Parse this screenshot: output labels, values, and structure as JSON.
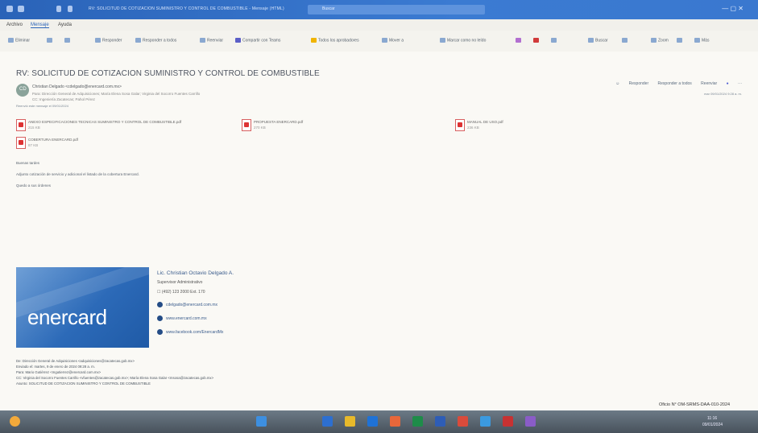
{
  "window": {
    "title": "RV: SOLICITUD DE COTIZACION SUMINISTRO Y CONTROL DE COMBUSTIBLE - Mensaje (HTML)",
    "search_placeholder": "Buscar"
  },
  "menu": {
    "items": [
      "Archivo",
      "Mensaje",
      "Ayuda"
    ]
  },
  "toolbar": {
    "delete": "Eliminar",
    "reply": "Responder",
    "reply_all": "Responder a todos",
    "forward": "Reenviar",
    "teams": "Compartir con Teams",
    "quicksteps": "Todos los aprobadores",
    "move": "Mover a",
    "mark_read": "Marcar como no leído",
    "search": "Buscar",
    "zoom": "Zoom",
    "more": "Más"
  },
  "email": {
    "subject": "RV: SOLICITUD DE COTIZACION SUMINISTRO Y CONTROL DE COMBUSTIBLE",
    "avatar": "CD",
    "sender": "Christian Delgado <cdelgado@enercard.com.mx>",
    "to": "Para: Dirección General de Adquisiciones; María Elena Sosa Galar; Virginia del Socorro Fuentes Carrillo",
    "cc": "CC: Ingeniería Zacatecas; Pahol Pérez",
    "forwarded": "Reenvió este mensaje el 09/01/2024",
    "actions": [
      "Responder",
      "Responder a todos",
      "Reenviar"
    ],
    "date": "mar 09/01/2024 9:28 a. m."
  },
  "attachments": [
    {
      "name": "ANEXO ESPECIFICACIONES TECNICAS SUMINISTRO Y CONTROL DE COMBUSTIBLE.pdf",
      "size": "215 KB"
    },
    {
      "name": "PROPUESTA ENERCARD.pdf",
      "size": "270 KB"
    },
    {
      "name": "MANUAL DE USO.pdf",
      "size": "236 KB"
    },
    {
      "name": "COBERTURA ENERCARD.pdf",
      "size": "87 KB"
    }
  ],
  "body": {
    "greeting": "Buenas tardes",
    "line1": "Adjunto cotización de servicio y adicional el listado de la cobertura Enercard.",
    "closing": "Quedo a sus órdenes"
  },
  "signature": {
    "logo_a": "ener",
    "logo_b": "card",
    "name": "Lic. Christian Octavio Delgado A.",
    "role": "Supervisor Administrativo",
    "phone": "(492) 123 2000 Ext. 170",
    "email": "cdelgado@enercard.com.mx",
    "web": "www.enercard.com.mx",
    "fb": "www.facebook.com/EnercardMx"
  },
  "forward_header": {
    "de": "De: Dirección General de Adquisiciones <adquisiciones@zacatecas.gob.mx>",
    "enviado": "Enviado el: martes, 9 de enero de 2024 09:28 a. m.",
    "para": "Para: Mario Gutiérrez <mgutierrez@enercard.com.mx>",
    "cc": "CC: Virginia del Socorro Fuentes Carrillo <vfuentes@zacatecas.gob.mx>; María Elena Sosa Galar <msosa@zacatecas.gob.mx>",
    "asunto": "Asunto: SOLICITUD DE COTIZACION SUMINISTRO Y CONTROL DE COMBUSTIBLE"
  },
  "stamp": "Oficio N° OM-SRMS-DAA-010-2024",
  "taskbar": {
    "clock": "11:16",
    "date": "09/01/2024"
  }
}
